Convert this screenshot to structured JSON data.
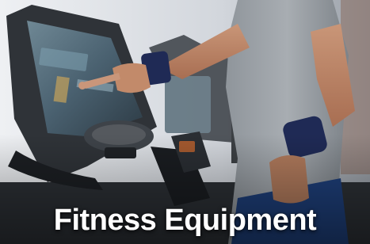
{
  "caption": "Fitness Equipment",
  "colors": {
    "caption_text": "#ffffff",
    "wall": "#d4d8de",
    "console_frame": "#2f3338",
    "console_screen": "#4f6b7a",
    "shirt": "#9ba1a6",
    "skin": "#c28a6a",
    "wristband": "#1f2a55",
    "shorts": "#1e3f7a"
  },
  "scene": {
    "subject": "person-using-treadmill-touchscreen",
    "icons": [
      "treadmill-console",
      "pointing-hand",
      "wristband"
    ]
  }
}
